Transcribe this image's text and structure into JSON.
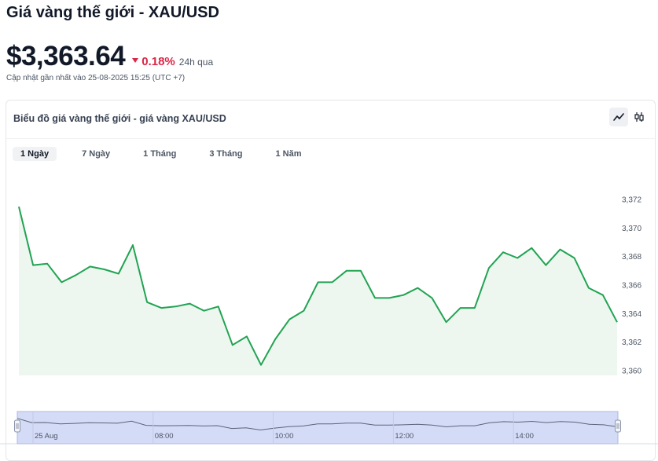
{
  "header": {
    "title": "Giá vàng thế giới - XAU/USD",
    "price": "$3,363.64",
    "change_pct": "0.18%",
    "change_period": "24h qua",
    "updated": "Cập nhật gần nhất vào 25-08-2025 15:25 (UTC +7)"
  },
  "card": {
    "title": "Biểu đồ giá vàng thế giới - giá vàng XAU/USD",
    "tabs": [
      "1 Ngày",
      "7 Ngày",
      "1 Tháng",
      "3 Tháng",
      "1 Năm"
    ],
    "active_tab": 0,
    "view_modes": [
      "line-chart-icon",
      "candlestick-icon"
    ]
  },
  "colors": {
    "line": "#21a352",
    "area": "#edf7ef",
    "down": "#dc2547",
    "navigator": "#d4dbf7"
  },
  "chart_data": {
    "type": "area",
    "ylim": [
      3360,
      3372
    ],
    "yticks": [
      3360,
      3362,
      3364,
      3366,
      3368,
      3370,
      3372
    ],
    "ytick_labels": [
      "3,360",
      "3,362",
      "3,364",
      "3,366",
      "3,368",
      "3,370",
      "3,372"
    ],
    "series": [
      {
        "values": [
          3371.5,
          3367.4,
          3367.5,
          3366.2,
          3366.7,
          3367.3,
          3367.1,
          3366.8,
          3368.8,
          3364.8,
          3364.4,
          3364.5,
          3364.7,
          3364.2,
          3364.5,
          3361.8,
          3362.4,
          3360.4,
          3362.2,
          3363.6,
          3364.2,
          3366.2,
          3366.2,
          3367.0,
          3367.0,
          3365.1,
          3365.1,
          3365.3,
          3365.8,
          3365.1,
          3363.4,
          3364.4,
          3364.4,
          3367.2,
          3368.3,
          3367.9,
          3368.6,
          3367.4,
          3368.5,
          3367.9,
          3365.8,
          3365.3,
          3363.4
        ]
      }
    ],
    "navigator": {
      "x_labels": [
        "25 Aug",
        "08:00",
        "10:00",
        "12:00",
        "14:00"
      ]
    }
  }
}
